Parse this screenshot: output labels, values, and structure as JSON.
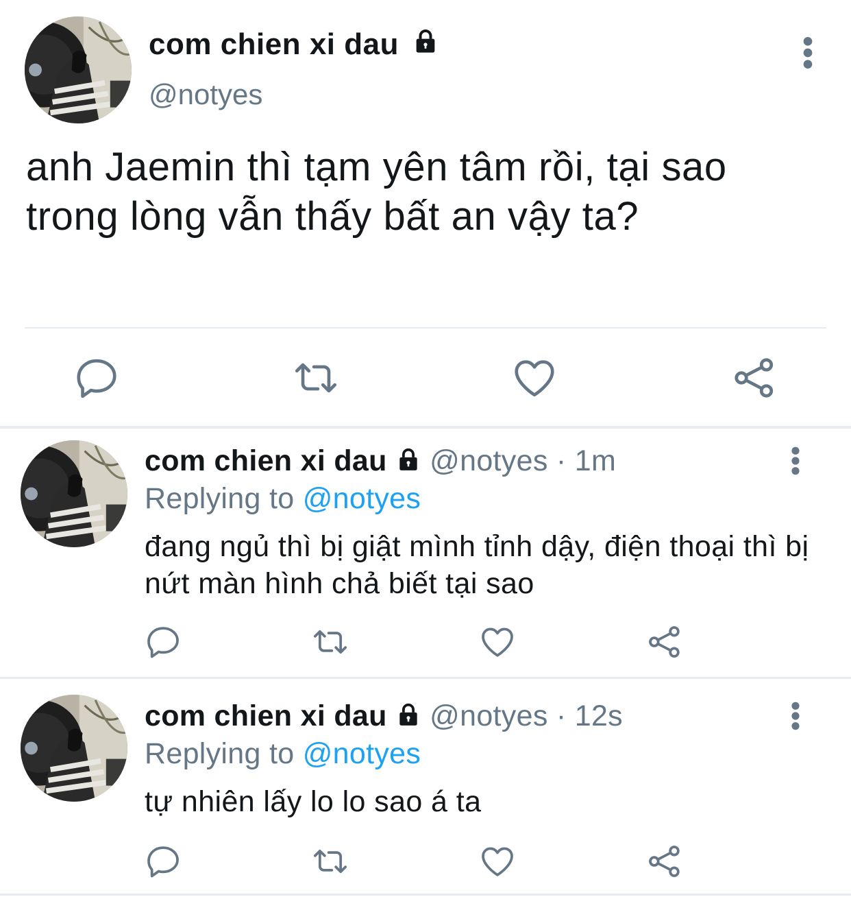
{
  "main_tweet": {
    "display_name": "com chien xi dau",
    "handle": "@notyes",
    "text": "anh Jaemin thì tạm yên tâm rồi, tại sao trong lòng vẫn thấy bất an vậy ta?",
    "actions": [
      "reply-icon",
      "retweet-icon",
      "like-icon",
      "share-icon"
    ]
  },
  "replies": [
    {
      "display_name": "com chien xi dau",
      "handle": "@notyes",
      "time": "1m",
      "replying_prefix": "Replying to",
      "replying_to": "@notyes",
      "text": "đang ngủ thì bị giật mình tỉnh dậy, điện thoại thì bị nứt màn hình chả biết tại sao"
    },
    {
      "display_name": "com chien xi dau",
      "handle": "@notyes",
      "time": "12s",
      "replying_prefix": "Replying to",
      "replying_to": "@notyes",
      "text": "tự nhiên lấy lo lo sao á ta"
    }
  ],
  "colors": {
    "text": "#14171a",
    "secondary": "#657786",
    "link": "#1da1f2",
    "divider": "#e6ecf0"
  }
}
